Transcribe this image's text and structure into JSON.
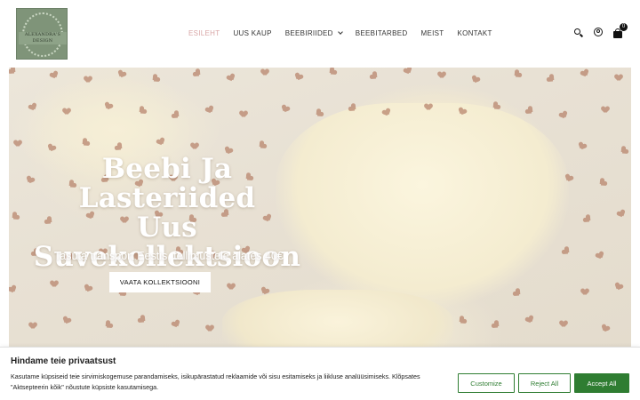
{
  "header": {
    "logo_text": "ALEXANDRA'S DESIGN",
    "nav": [
      {
        "label": "ESILEHT",
        "active": true
      },
      {
        "label": "UUS KAUP",
        "active": false
      },
      {
        "label": "BEEBIRIIDED",
        "active": false,
        "has_dropdown": true
      },
      {
        "label": "BEEBITARBED",
        "active": false
      },
      {
        "label": "MEIST",
        "active": false
      },
      {
        "label": "KONTAKT",
        "active": false
      }
    ],
    "cart_count": "0",
    "icons": [
      "search-icon",
      "account-icon",
      "cart-icon"
    ]
  },
  "hero": {
    "title_line1": "Beebi Ja Lasteriided",
    "title_line2": "Uus",
    "title_line3": "Suvekollektsioon",
    "subtitle": "Tasuta transport Eestis, tellimustele alates 40€",
    "cta_label": "VAATA KOLLEKTSIOONI"
  },
  "cookie_banner": {
    "title": "Hindame teie privaatsust",
    "text": "Kasutame küpsiseid teie sirvimiskogemuse parandamiseks, isikupärastatud reklaamide või sisu esitamiseks ja liikluse analüüsimiseks. Klõpsates \"Aktsepteerin kõik\" nõustute küpsiste kasutamisega.",
    "customize_label": "Customize",
    "reject_label": "Reject All",
    "accept_label": "Accept All"
  },
  "colors": {
    "active_nav": "#d8a6a6",
    "accent_green": "#2f7d32",
    "logo_green": "#7f9479"
  }
}
